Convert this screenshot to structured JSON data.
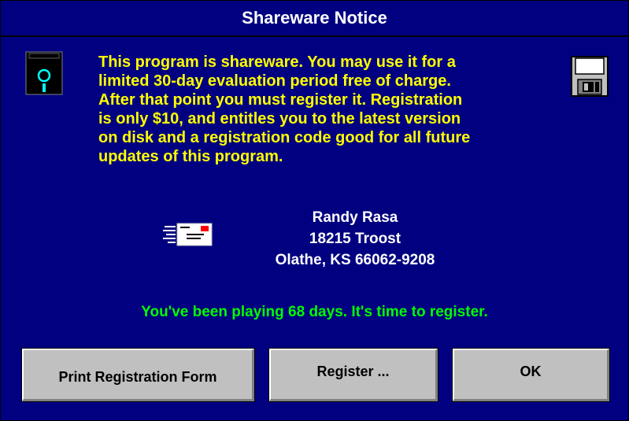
{
  "window": {
    "title": "Shareware Notice"
  },
  "notice": {
    "lines": [
      "This program is shareware.  You may use it for a",
      "limited 30-day evaluation period free of charge.",
      "After that point you must register it.  Registration",
      "is only $10, and entitles you to the latest version",
      "on disk and a registration code good for all future",
      "updates of this program."
    ]
  },
  "address": {
    "name": "Randy Rasa",
    "street": "18215 Troost",
    "city": "Olathe, KS 66062-9208"
  },
  "status": "You've been playing 68 days.  It's time to register.",
  "buttons": {
    "print": "Print Registration Form",
    "register": "Register ...",
    "ok": "OK"
  },
  "icons": {
    "left": "floppy-disk-icon",
    "right": "floppy-disk-icon",
    "mail": "envelope-icon"
  },
  "colors": {
    "background": "#000080",
    "notice_text": "#ffff00",
    "address_text": "#ffffff",
    "status_text": "#00ff00",
    "button_face": "#c0c0c0"
  }
}
